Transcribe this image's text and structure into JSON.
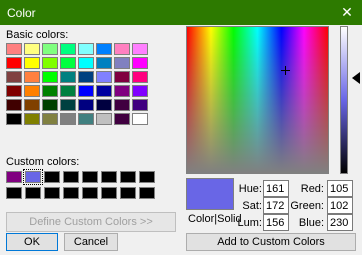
{
  "title": "Color",
  "close_glyph": "✕",
  "basic_colors_label": "Basic colors:",
  "custom_colors_label": "Custom colors:",
  "basic_colors": [
    "#ff8080",
    "#ffff80",
    "#80ff80",
    "#00ff80",
    "#80ffff",
    "#0080ff",
    "#ff80c0",
    "#ff80ff",
    "#ff0000",
    "#ffff00",
    "#80ff00",
    "#00ff40",
    "#00ffff",
    "#0080c0",
    "#8080c0",
    "#ff00ff",
    "#804040",
    "#ff8040",
    "#00ff00",
    "#008080",
    "#004080",
    "#8080ff",
    "#800040",
    "#ff0080",
    "#800000",
    "#ff8000",
    "#008000",
    "#008040",
    "#0000ff",
    "#0000a0",
    "#800080",
    "#8000ff",
    "#400000",
    "#804000",
    "#004000",
    "#004040",
    "#000080",
    "#000040",
    "#400040",
    "#400080",
    "#000000",
    "#808000",
    "#808040",
    "#808080",
    "#408080",
    "#c0c0c0",
    "#400040",
    "#ffffff"
  ],
  "custom_colors": [
    "#800080",
    "#6966e6",
    "#000000",
    "#000000",
    "#000000",
    "#000000",
    "#000000",
    "#000000",
    "#000000",
    "#000000",
    "#000000",
    "#000000",
    "#000000",
    "#000000",
    "#000000",
    "#000000"
  ],
  "buttons": {
    "define_custom": "Define Custom Colors >>",
    "ok": "OK",
    "cancel": "Cancel",
    "add_custom": "Add to Custom Colors"
  },
  "color_solid_label": "Color|Solid",
  "current_color": "#6966e6",
  "fields": {
    "hue_label": "Hue:",
    "hue": "161",
    "sat_label": "Sat:",
    "sat": "172",
    "lum_label": "Lum:",
    "lum": "156",
    "red_label": "Red:",
    "red": "105",
    "green_label": "Green:",
    "green": "102",
    "blue_label": "Blue:",
    "blue": "230"
  }
}
